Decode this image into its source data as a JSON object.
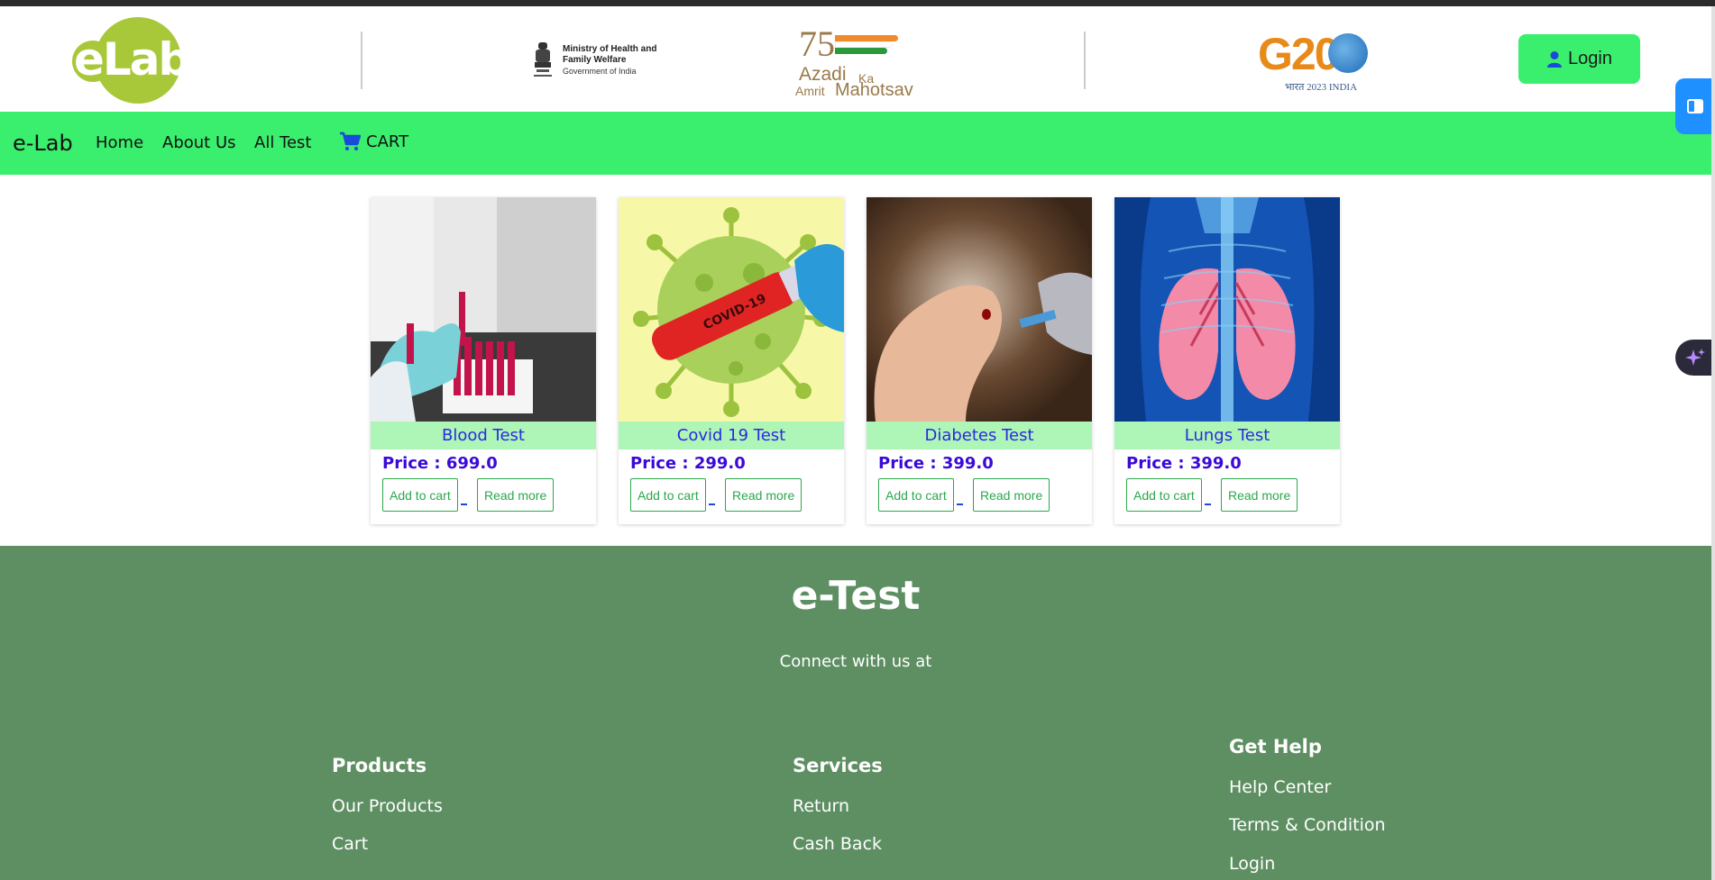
{
  "header": {
    "logo_text": "eLab",
    "ministry": {
      "line1": "Ministry of Health and",
      "line2": "Family Welfare",
      "line3": "Government of India"
    },
    "azadi": {
      "number": "75",
      "line1": "Azadi",
      "line2": "Ka",
      "line3": "Amrit",
      "line4": "Mahotsav"
    },
    "g20": {
      "text": "G20",
      "sub": "भारत 2023 INDIA"
    },
    "login_label": "Login"
  },
  "navbar": {
    "brand": "e-Lab",
    "items": [
      "Home",
      "About Us",
      "All Test"
    ],
    "cart_label": "CART"
  },
  "products": [
    {
      "title": "Blood Test",
      "price": "Price : 699.0",
      "add_label": "Add to cart",
      "more_label": "Read more"
    },
    {
      "title": "Covid 19 Test",
      "price": "Price : 299.0",
      "add_label": "Add to cart",
      "more_label": "Read more",
      "tube_label": "COVID-19"
    },
    {
      "title": "Diabetes Test",
      "price": "Price : 399.0",
      "add_label": "Add to cart",
      "more_label": "Read more"
    },
    {
      "title": "Lungs Test",
      "price": "Price : 399.0",
      "add_label": "Add to cart",
      "more_label": "Read more"
    }
  ],
  "footer": {
    "title": "e-Test",
    "connect": "Connect with us at",
    "columns": [
      {
        "heading": "Products",
        "links": [
          "Our Products",
          "Cart"
        ]
      },
      {
        "heading": "Services",
        "links": [
          "Return",
          "Cash Back"
        ]
      },
      {
        "heading": "Get Help",
        "links": [
          "Help Center",
          "Terms & Condition",
          "Login"
        ]
      }
    ]
  },
  "colors": {
    "nav_green": "#3aee6e",
    "footer_green": "#5e8f62",
    "card_title_bg": "#aef5b8",
    "price_color": "#3a0ad8",
    "button_green": "#2aa84a",
    "logo_green": "#a8c83a"
  },
  "icons": {
    "login": "user-icon",
    "cart": "cart-icon",
    "side_tab": "panel-icon",
    "side_ai": "sparkle-icon"
  }
}
